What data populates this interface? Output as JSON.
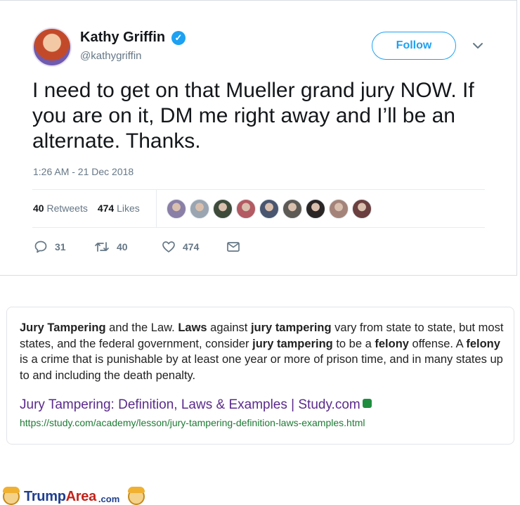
{
  "tweet": {
    "user_name": "Kathy Griffin",
    "handle": "@kathygriffin",
    "follow_label": "Follow",
    "text": "I need to get on that Mueller grand jury NOW. If you are on it, DM me right away and I’ll be an alternate. Thanks.",
    "timestamp": "1:26 AM - 21 Dec 2018",
    "retweets_count": "40",
    "retweets_label": "Retweets",
    "likes_count": "474",
    "likes_label": "Likes",
    "likers": [
      "#8a7fa6",
      "#9aa5b1",
      "#3f4b3a",
      "#b35a62",
      "#4a5670",
      "#5d5a55",
      "#2a2626",
      "#a4847a",
      "#6b3f3f"
    ],
    "actions": {
      "reply_count": "31",
      "retweet_count": "40",
      "like_count": "474"
    },
    "accent_color": "#1da1f2"
  },
  "snippet": {
    "segments": [
      {
        "text": "Jury Tampering",
        "bold": true
      },
      {
        "text": " and the Law. ",
        "bold": false
      },
      {
        "text": "Laws",
        "bold": true
      },
      {
        "text": " against ",
        "bold": false
      },
      {
        "text": "jury tampering",
        "bold": true
      },
      {
        "text": " vary from state to state, but most states, and the federal government, consider ",
        "bold": false
      },
      {
        "text": "jury tampering",
        "bold": true
      },
      {
        "text": " to be a ",
        "bold": false
      },
      {
        "text": "felony",
        "bold": true
      },
      {
        "text": " offense. A ",
        "bold": false
      },
      {
        "text": "felony",
        "bold": true
      },
      {
        "text": " is a crime that is punishable by at least one year or more of prison time, and in many states up to and including the death penalty.",
        "bold": false
      }
    ],
    "result_title": "Jury Tampering: Definition, Laws & Examples | Study.com",
    "result_url": "https://study.com/academy/lesson/jury-tampering-definition-laws-examples.html"
  },
  "watermark": {
    "brand_part1": "Trump",
    "brand_part2": "Area",
    "suffix": ".com"
  }
}
